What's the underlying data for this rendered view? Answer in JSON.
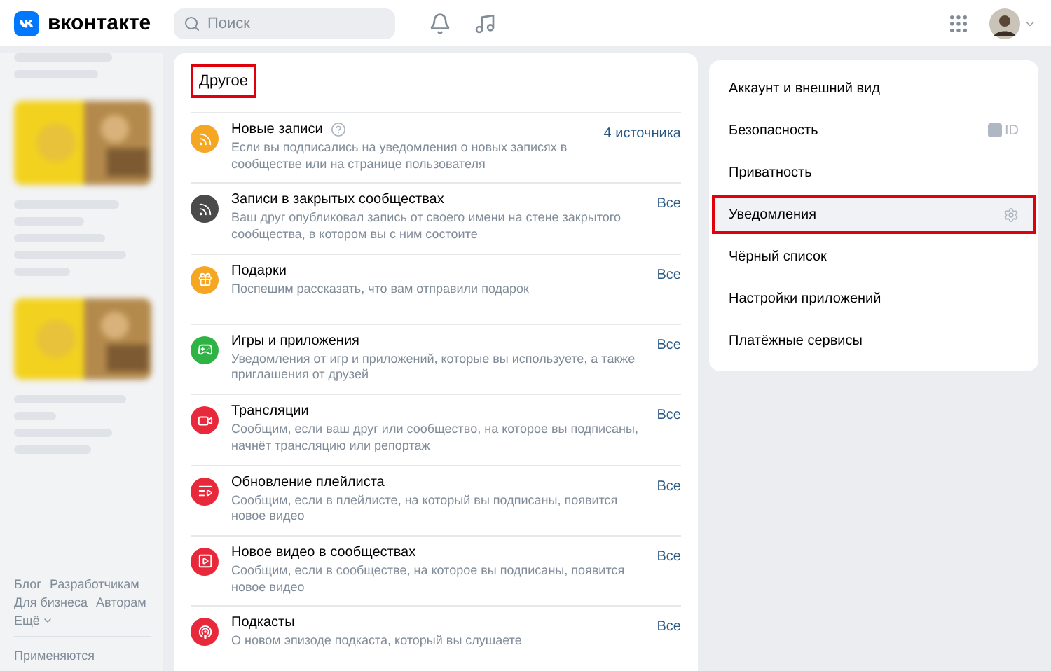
{
  "header": {
    "logo": "вконтакте",
    "search": {
      "placeholder": "Поиск"
    }
  },
  "left_sidebar": {
    "links": [
      "Блог",
      "Разработчикам",
      "Для бизнеса",
      "Авторам"
    ],
    "more": "Ещё",
    "notice": "Применяются"
  },
  "section": {
    "title": "Другое",
    "highlighted": true,
    "rows": [
      {
        "title": "Новые записи",
        "help": true,
        "description": "Если вы подписались на уведомления о новых записях в сообществе или на странице пользователя",
        "value": "4 источника",
        "color": "#f5a623",
        "kind": "rss"
      },
      {
        "title": "Записи в закрытых сообществах",
        "help": false,
        "description": "Ваш друг опубликовал запись от своего имени на стене закрытого сообщества, в котором вы с ним состоите",
        "value": "Все",
        "color": "#4a4a4a",
        "kind": "rss"
      },
      {
        "title": "Подарки",
        "help": false,
        "description": "Поспешим рассказать, что вам отправили подарок",
        "value": "Все",
        "color": "#f5a623",
        "kind": "gift"
      },
      {
        "title": "Игры и приложения",
        "help": false,
        "description": "Уведомления от игр и приложений, которые вы используете, а также приглашения от друзей",
        "value": "Все",
        "color": "#2fb344",
        "kind": "game"
      },
      {
        "title": "Трансляции",
        "help": false,
        "description": "Сообщим, если ваш друг или сообщество, на которое вы подписаны, начнёт трансляцию или репортаж",
        "value": "Все",
        "color": "#e8293b",
        "kind": "video"
      },
      {
        "title": "Обновление плейлиста",
        "help": false,
        "description": "Сообщим, если в плейлисте, на который вы подписаны, появится новое видео",
        "value": "Все",
        "color": "#e8293b",
        "kind": "playlist"
      },
      {
        "title": "Новое видео в сообществах",
        "help": false,
        "description": "Сообщим, если в сообществе, на которое вы подписаны, появится новое видео",
        "value": "Все",
        "color": "#e8293b",
        "kind": "clip"
      },
      {
        "title": "Подкасты",
        "help": false,
        "description": "О новом эпизоде подкаста, который вы слушаете",
        "value": "Все",
        "color": "#e8293b",
        "kind": "podcast"
      }
    ]
  },
  "settings_menu": {
    "items": [
      {
        "label": "Аккаунт и внешний вид",
        "selected": false,
        "highlighted": false
      },
      {
        "label": "Безопасность",
        "selected": false,
        "highlighted": false,
        "badge": "ID"
      },
      {
        "label": "Приватность",
        "selected": false,
        "highlighted": false
      },
      {
        "label": "Уведомления",
        "selected": true,
        "highlighted": true
      },
      {
        "label": "Чёрный список",
        "selected": false,
        "highlighted": false
      },
      {
        "label": "Настройки приложений",
        "selected": false,
        "highlighted": false
      },
      {
        "label": "Платёжные сервисы",
        "selected": false,
        "highlighted": false
      }
    ]
  }
}
